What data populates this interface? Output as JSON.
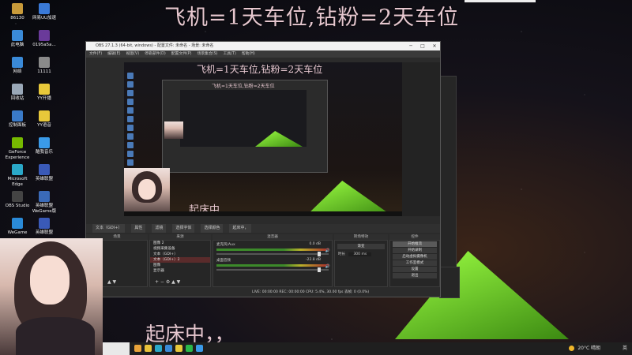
{
  "banner": {
    "text": "飞机=1天车位,钻粉=2天车位"
  },
  "caption": {
    "text": "起床中，，"
  },
  "desktop": {
    "icons": [
      {
        "label": "86130",
        "color": "#c89a3a"
      },
      {
        "label": "网易UU加速",
        "color": "#3a7ad8"
      },
      {
        "label": "此电脑",
        "color": "#3a8ad8"
      },
      {
        "label": "0195a5a...",
        "color": "#6a3a9a"
      },
      {
        "label": "网络",
        "color": "#3a8ad8"
      },
      {
        "label": "11111",
        "color": "#8a8a8a"
      },
      {
        "label": "回收站",
        "color": "#9aa8b8"
      },
      {
        "label": "YY开播",
        "color": "#e8c83a"
      },
      {
        "label": "控制面板",
        "color": "#3a7ac8"
      },
      {
        "label": "YY语音",
        "color": "#e8c83a"
      },
      {
        "label": "GeForce Experience",
        "color": "#76b900"
      },
      {
        "label": "酷我音乐",
        "color": "#3a9ae8"
      },
      {
        "label": "Microsoft Edge",
        "color": "#2aa8c8"
      },
      {
        "label": "英雄联盟",
        "color": "#3a5ab8"
      },
      {
        "label": "OBS Studio",
        "color": "#444"
      },
      {
        "label": "英雄联盟WeGame版",
        "color": "#3a6ab8"
      },
      {
        "label": "WeGame",
        "color": "#2a8ad8"
      },
      {
        "label": "英雄联盟",
        "color": "#3a5ab8"
      }
    ]
  },
  "obs": {
    "title": "OBS 27.1.3 (64-bit, windows) - 配置文件: 未命名 - 场景: 未命名",
    "menu": [
      "文件(F)",
      "编辑(E)",
      "视图(V)",
      "停靠部件(D)",
      "配置文件(P)",
      "场景集合(S)",
      "工具(T)",
      "帮助(H)"
    ],
    "preview_banner": "飞机=1天车位,钻粉=2天车位",
    "preview_caption": "起床中",
    "control_bar": [
      "文本（GDI+）",
      "属性",
      "滤镜",
      "选择字体",
      "选择颜色",
      "起床中，"
    ],
    "docks": {
      "scenes": "场景",
      "sources": "来源",
      "mixer": "混音器",
      "transitions": "转场特效",
      "controls": "控件"
    },
    "sources": [
      {
        "label": "图像 2",
        "selected": false
      },
      {
        "label": "视频采集设备",
        "selected": false
      },
      {
        "label": "文本（GDI+）",
        "selected": false
      },
      {
        "label": "文本（GDI+）2",
        "selected": true
      },
      {
        "label": "图像",
        "selected": false
      },
      {
        "label": "显示器",
        "selected": false
      }
    ],
    "mixer": [
      {
        "label": "麦克风/Aux",
        "value": "0.0 dB"
      },
      {
        "label": "桌面音频",
        "value": "-22.8 dB"
      }
    ],
    "transition": {
      "mode": "渐变",
      "duration_label": "时长",
      "duration_value": "300 ms"
    },
    "controls": [
      "开始推流",
      "开始录制",
      "启动虚拟摄像机",
      "工作室模式",
      "设置",
      "退出"
    ],
    "status": "LIVE: 00:00:00   REC: 00:00:00   CPU: 5.4%, 30.00 fps   丢帧: 0 (0.0%)"
  },
  "taskbar": {
    "weather": "20°C 晴朗",
    "lang": "英",
    "apps": [
      {
        "name": "obs",
        "color": "#e8a33a"
      },
      {
        "name": "folder",
        "color": "#e8c23a"
      },
      {
        "name": "edge",
        "color": "#2aa8c8"
      },
      {
        "name": "store",
        "color": "#3a8ad8"
      },
      {
        "name": "yy",
        "color": "#e8c83a"
      },
      {
        "name": "wechat",
        "color": "#2ab84a"
      },
      {
        "name": "music",
        "color": "#3a9ae8"
      }
    ]
  },
  "colors": {
    "accent_pink": "#e6c7cf",
    "tent_green": "#9dff43"
  }
}
